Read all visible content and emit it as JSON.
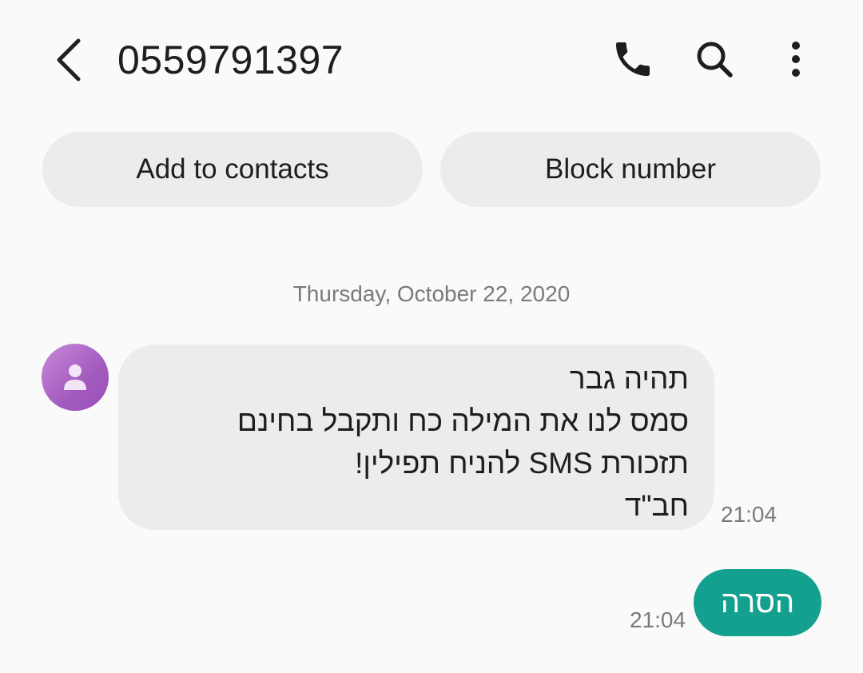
{
  "header": {
    "title": "0559791397",
    "back_icon": "chevron-left-icon",
    "call_icon": "phone-icon",
    "search_icon": "search-icon",
    "more_icon": "more-vert-icon"
  },
  "actions": {
    "add_to_contacts_label": "Add to contacts",
    "block_number_label": "Block number"
  },
  "conversation": {
    "date_separator": "Thursday, October 22, 2020",
    "incoming": {
      "avatar_icon": "person-icon",
      "avatar_color": "#b06cc8",
      "lines": [
        "תהיה גבר",
        "סמס לנו את המילה כח ותקבל בחינם",
        "תזכורת SMS להניח תפילין!",
        "חב\"ד"
      ],
      "time": "21:04"
    },
    "outgoing": {
      "text": "הסרה",
      "time": "21:04",
      "bubble_color": "#14a08f"
    }
  }
}
